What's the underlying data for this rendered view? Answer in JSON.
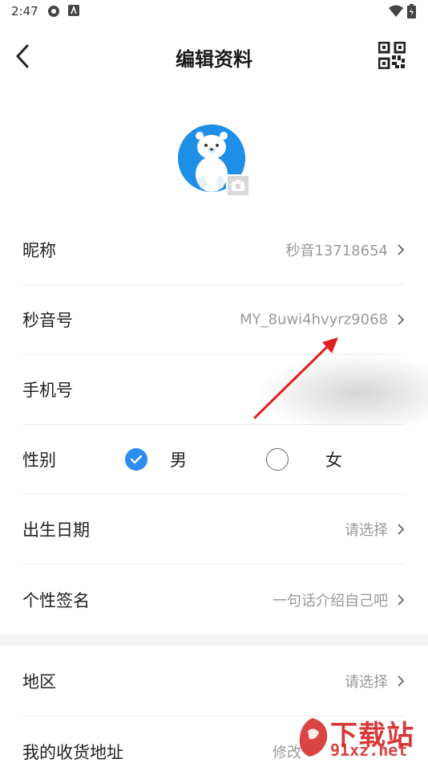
{
  "status_bar": {
    "time": "2:47"
  },
  "header": {
    "title": "编辑资料"
  },
  "rows": {
    "nickname": {
      "label": "昵称",
      "value": "秒音13718654"
    },
    "miaoyin_id": {
      "label": "秒音号",
      "value": "MY_8uwi4hvyrz9068"
    },
    "phone": {
      "label": "手机号",
      "value": ""
    },
    "gender": {
      "label": "性别",
      "male": "男",
      "female": "女",
      "selected": "male"
    },
    "birthday": {
      "label": "出生日期",
      "value": "请选择"
    },
    "signature": {
      "label": "个性签名",
      "value": "一句话介绍自己吧"
    },
    "region": {
      "label": "地区",
      "value": "请选择"
    },
    "address": {
      "label": "我的收货地址",
      "value": "修改"
    }
  },
  "watermark": {
    "logo_text": "下载站",
    "url_text": "91xz.net"
  },
  "colors": {
    "accent": "#2d8cf0",
    "avatar_bg": "#1e8fe6",
    "annotation_arrow": "#e02020"
  }
}
